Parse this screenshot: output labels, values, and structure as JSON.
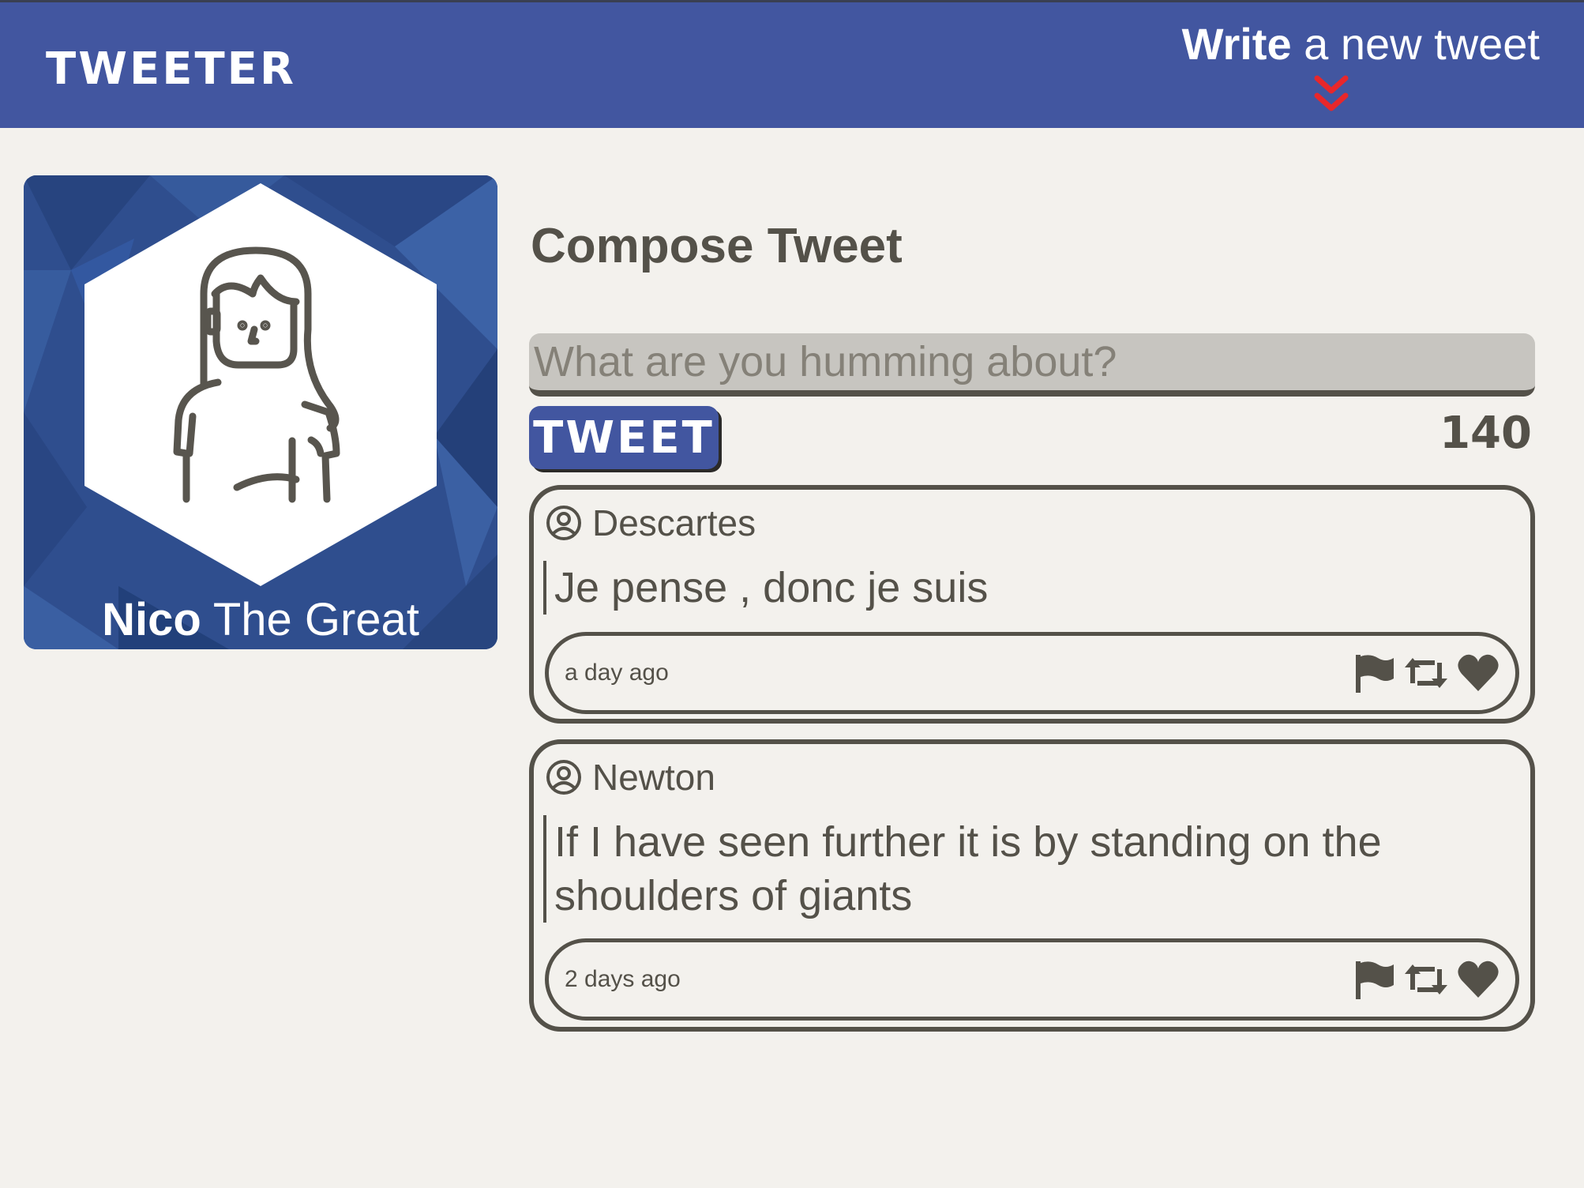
{
  "nav": {
    "brand": "TWEETER",
    "write_bold": "Write",
    "write_rest": " a new tweet",
    "toggle_icon": "double-chevron-down-icon",
    "toggle_color": "#e8272b"
  },
  "profile": {
    "first_name": "Nico",
    "rest_name": " The Great",
    "avatar_icon": "user-avatar-icon"
  },
  "compose": {
    "title": "Compose Tweet",
    "placeholder": "What are you humming about?",
    "value": "",
    "button_label": "TWEET",
    "counter": "140"
  },
  "tweets": [
    {
      "author": "Descartes",
      "body": "Je pense , donc je suis",
      "time": "a day ago",
      "actions": [
        "flag-icon",
        "retweet-icon",
        "heart-icon"
      ]
    },
    {
      "author": "Newton",
      "body": "If I have seen further it is by standing on the shoulders of giants",
      "time": "2 days ago",
      "actions": [
        "flag-icon",
        "retweet-icon",
        "heart-icon"
      ]
    }
  ],
  "colors": {
    "nav_bg": "#4256a0",
    "page_bg": "#f3f1ed",
    "text": "#545149",
    "input_bg": "#c7c5c0",
    "accent": "#e8272b"
  }
}
